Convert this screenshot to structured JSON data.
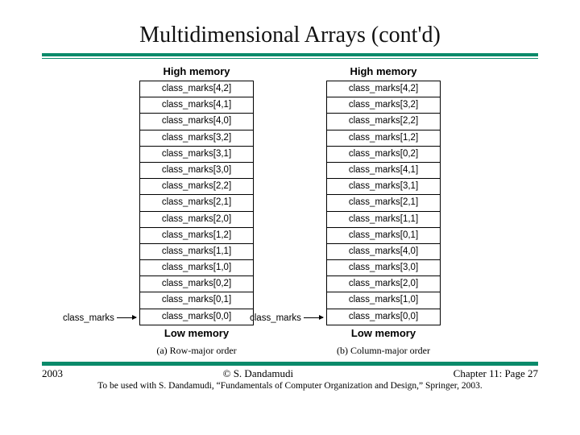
{
  "title": "Multidimensional Arrays (cont'd)",
  "high_memory_label": "High memory",
  "low_memory_label": "Low memory",
  "pointer_label": "class_marks",
  "left": {
    "caption": "(a) Row-major order",
    "cells": [
      "class_marks[4,2]",
      "class_marks[4,1]",
      "class_marks[4,0]",
      "class_marks[3,2]",
      "class_marks[3,1]",
      "class_marks[3,0]",
      "class_marks[2,2]",
      "class_marks[2,1]",
      "class_marks[2,0]",
      "class_marks[1,2]",
      "class_marks[1,1]",
      "class_marks[1,0]",
      "class_marks[0,2]",
      "class_marks[0,1]",
      "class_marks[0,0]"
    ]
  },
  "right": {
    "caption": "(b) Column-major order",
    "cells": [
      "class_marks[4,2]",
      "class_marks[3,2]",
      "class_marks[2,2]",
      "class_marks[1,2]",
      "class_marks[0,2]",
      "class_marks[4,1]",
      "class_marks[3,1]",
      "class_marks[2,1]",
      "class_marks[1,1]",
      "class_marks[0,1]",
      "class_marks[4,0]",
      "class_marks[3,0]",
      "class_marks[2,0]",
      "class_marks[1,0]",
      "class_marks[0,0]"
    ]
  },
  "footer": {
    "year": "2003",
    "author": "© S. Dandamudi",
    "page": "Chapter 11: Page 27",
    "credit": "To be used with S. Dandamudi, “Fundamentals of Computer Organization and Design,” Springer, 2003."
  }
}
